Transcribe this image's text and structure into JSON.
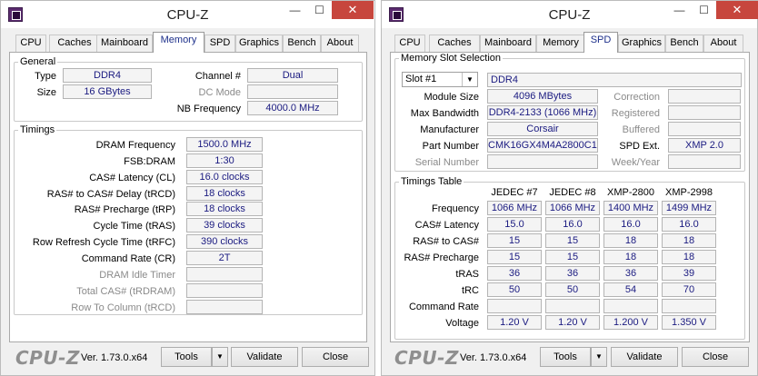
{
  "left_window": {
    "title": "CPU-Z",
    "window_controls": {
      "minimize": "—",
      "maximize": "☐",
      "close": "✕"
    },
    "tabs": [
      "CPU",
      "Caches",
      "Mainboard",
      "Memory",
      "SPD",
      "Graphics",
      "Bench",
      "About"
    ],
    "active_tab": "Memory",
    "general": {
      "legend": "General",
      "type_label": "Type",
      "type_value": "DDR4",
      "size_label": "Size",
      "size_value": "16 GBytes",
      "channel_label": "Channel #",
      "channel_value": "Dual",
      "dc_mode_label": "DC Mode",
      "dc_mode_value": "",
      "nb_freq_label": "NB Frequency",
      "nb_freq_value": "4000.0 MHz"
    },
    "timings": {
      "legend": "Timings",
      "rows": [
        {
          "label": "DRAM Frequency",
          "value": "1500.0 MHz",
          "disabled": false
        },
        {
          "label": "FSB:DRAM",
          "value": "1:30",
          "disabled": false
        },
        {
          "label": "CAS# Latency (CL)",
          "value": "16.0 clocks",
          "disabled": false
        },
        {
          "label": "RAS# to CAS# Delay (tRCD)",
          "value": "18 clocks",
          "disabled": false
        },
        {
          "label": "RAS# Precharge (tRP)",
          "value": "18 clocks",
          "disabled": false
        },
        {
          "label": "Cycle Time (tRAS)",
          "value": "39 clocks",
          "disabled": false
        },
        {
          "label": "Row Refresh Cycle Time (tRFC)",
          "value": "390 clocks",
          "disabled": false
        },
        {
          "label": "Command Rate (CR)",
          "value": "2T",
          "disabled": false
        },
        {
          "label": "DRAM Idle Timer",
          "value": "",
          "disabled": true
        },
        {
          "label": "Total CAS# (tRDRAM)",
          "value": "",
          "disabled": true
        },
        {
          "label": "Row To Column (tRCD)",
          "value": "",
          "disabled": true
        }
      ]
    },
    "footer": {
      "brand": "CPU-Z",
      "version": "Ver. 1.73.0.x64",
      "tools": "Tools",
      "validate": "Validate",
      "close": "Close"
    }
  },
  "right_window": {
    "title": "CPU-Z",
    "window_controls": {
      "minimize": "—",
      "maximize": "☐",
      "close": "✕"
    },
    "tabs": [
      "CPU",
      "Caches",
      "Mainboard",
      "Memory",
      "SPD",
      "Graphics",
      "Bench",
      "About"
    ],
    "active_tab": "SPD",
    "slot": {
      "legend": "Memory Slot Selection",
      "selected_slot": "Slot #1",
      "memory_type": "DDR4",
      "module_size_label": "Module Size",
      "module_size_value": "4096 MBytes",
      "max_bw_label": "Max Bandwidth",
      "max_bw_value": "DDR4-2133 (1066 MHz)",
      "manufacturer_label": "Manufacturer",
      "manufacturer_value": "Corsair",
      "part_number_label": "Part Number",
      "part_number_value": "CMK16GX4M4A2800C16",
      "serial_label": "Serial Number",
      "serial_value": "",
      "correction_label": "Correction",
      "correction_value": "",
      "registered_label": "Registered",
      "registered_value": "",
      "buffered_label": "Buffered",
      "buffered_value": "",
      "spd_ext_label": "SPD Ext.",
      "spd_ext_value": "XMP 2.0",
      "week_year_label": "Week/Year",
      "week_year_value": ""
    },
    "timings_table": {
      "legend": "Timings Table",
      "columns": [
        "JEDEC #7",
        "JEDEC #8",
        "XMP-2800",
        "XMP-2998"
      ],
      "rows": [
        {
          "label": "Frequency",
          "values": [
            "1066 MHz",
            "1066 MHz",
            "1400 MHz",
            "1499 MHz"
          ]
        },
        {
          "label": "CAS# Latency",
          "values": [
            "15.0",
            "16.0",
            "16.0",
            "16.0"
          ]
        },
        {
          "label": "RAS# to CAS#",
          "values": [
            "15",
            "15",
            "18",
            "18"
          ]
        },
        {
          "label": "RAS# Precharge",
          "values": [
            "15",
            "15",
            "18",
            "18"
          ]
        },
        {
          "label": "tRAS",
          "values": [
            "36",
            "36",
            "36",
            "39"
          ]
        },
        {
          "label": "tRC",
          "values": [
            "50",
            "50",
            "54",
            "70"
          ]
        },
        {
          "label": "Command Rate",
          "values": [
            "",
            "",
            "",
            ""
          ]
        },
        {
          "label": "Voltage",
          "values": [
            "1.20 V",
            "1.20 V",
            "1.200 V",
            "1.350 V"
          ]
        }
      ]
    },
    "footer": {
      "brand": "CPU-Z",
      "version": "Ver. 1.73.0.x64",
      "tools": "Tools",
      "validate": "Validate",
      "close": "Close"
    }
  }
}
